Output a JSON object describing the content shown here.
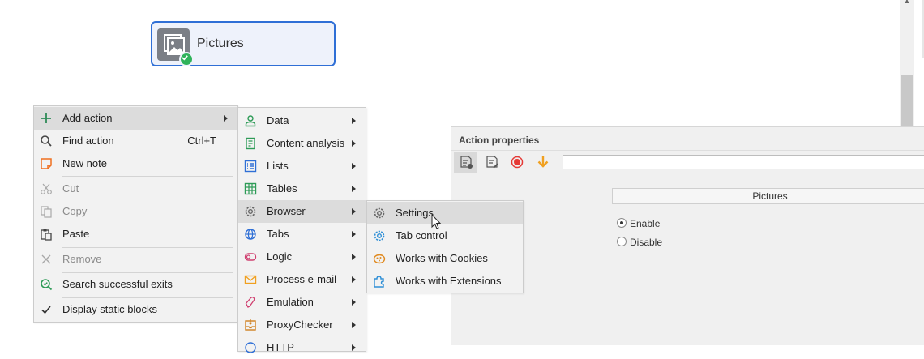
{
  "node": {
    "label": "Pictures",
    "status": "success"
  },
  "context_menu": {
    "items": [
      {
        "label": "Add action",
        "icon": "plus-icon"
      },
      {
        "label": "Find action",
        "shortcut": "Ctrl+T",
        "icon": "search-icon"
      },
      {
        "label": "New note",
        "icon": "note-icon"
      },
      {
        "label": "Cut",
        "icon": "scissors-icon",
        "disabled": true
      },
      {
        "label": "Copy",
        "icon": "copy-icon",
        "disabled": true
      },
      {
        "label": "Paste",
        "icon": "paste-icon"
      },
      {
        "label": "Remove",
        "icon": "close-icon",
        "disabled": true
      },
      {
        "label": "Search successful exits",
        "icon": "search-success-icon"
      },
      {
        "label": "Display static blocks",
        "icon": "checkmark-icon"
      }
    ]
  },
  "add_action_menu": {
    "items": [
      {
        "label": "Data"
      },
      {
        "label": "Content analysis"
      },
      {
        "label": "Lists"
      },
      {
        "label": "Tables"
      },
      {
        "label": "Browser"
      },
      {
        "label": "Tabs"
      },
      {
        "label": "Logic"
      },
      {
        "label": "Process e-mail"
      },
      {
        "label": "Emulation"
      },
      {
        "label": "ProxyChecker"
      },
      {
        "label": "HTTP"
      }
    ]
  },
  "browser_menu": {
    "items": [
      {
        "label": "Settings"
      },
      {
        "label": "Tab control"
      },
      {
        "label": "Works with Cookies"
      },
      {
        "label": "Works with Extensions"
      }
    ]
  },
  "properties": {
    "title": "Action properties",
    "input_value": "",
    "table_header": "Pictures",
    "options": [
      {
        "label": "Enable",
        "selected": true
      },
      {
        "label": "Disable",
        "selected": false
      }
    ]
  },
  "colors": {
    "accent": "#2f6fd6",
    "success": "#2fb35a",
    "record": "#e53935",
    "arrow_down": "#f0a020"
  }
}
